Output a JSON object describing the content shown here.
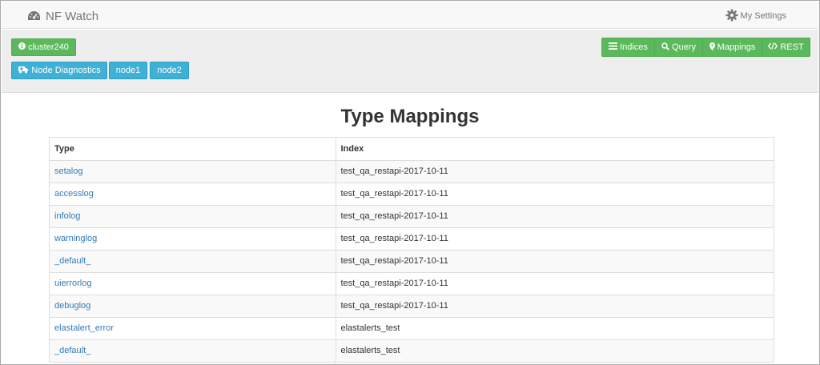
{
  "navbar": {
    "brand": "NF Watch",
    "settings_label": "My Settings"
  },
  "toolbar": {
    "cluster_label": "cluster240",
    "diagnostics_label": "Node Diagnostics",
    "nodes": [
      "node1",
      "node2"
    ],
    "nav_buttons": {
      "indices": "Indices",
      "query": "Query",
      "mappings": "Mappings",
      "rest": "REST"
    }
  },
  "main": {
    "title": "Type Mappings",
    "table": {
      "headers": {
        "type": "Type",
        "index": "Index"
      },
      "rows": [
        {
          "type": "setalog",
          "index": "test_qa_restapi-2017-10-11"
        },
        {
          "type": "accesslog",
          "index": "test_qa_restapi-2017-10-11"
        },
        {
          "type": "infolog",
          "index": "test_qa_restapi-2017-10-11"
        },
        {
          "type": "warninglog",
          "index": "test_qa_restapi-2017-10-11"
        },
        {
          "type": "_default_",
          "index": "test_qa_restapi-2017-10-11"
        },
        {
          "type": "uierrorlog",
          "index": "test_qa_restapi-2017-10-11"
        },
        {
          "type": "debuglog",
          "index": "test_qa_restapi-2017-10-11"
        },
        {
          "type": "elastalert_error",
          "index": "elastalerts_test"
        },
        {
          "type": "_default_",
          "index": "elastalerts_test"
        }
      ]
    }
  },
  "colors": {
    "green": "#5cb85c",
    "blue": "#3fb0d6",
    "link": "#337ab7"
  }
}
